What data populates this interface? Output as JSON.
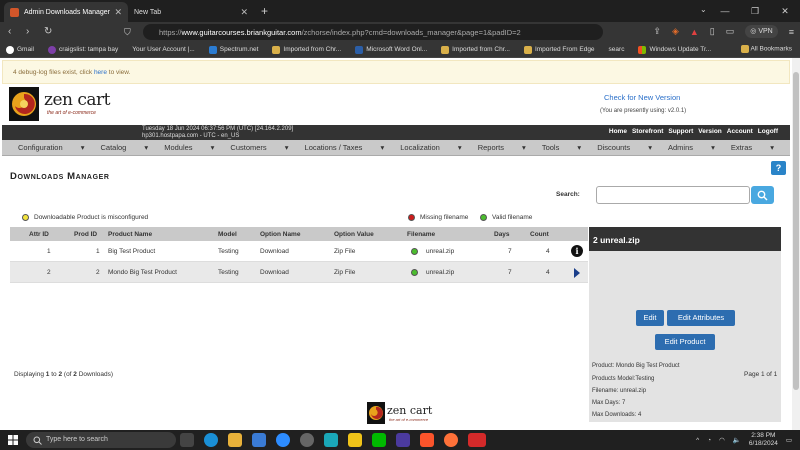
{
  "browser": {
    "tabs": [
      {
        "title": "Admin Downloads Manager",
        "active": true
      },
      {
        "title": "New Tab",
        "active": false
      }
    ],
    "url_prefix": "https://",
    "url_host": "www.guitarcourses.briankguitar.com",
    "url_path": "/zchorse/index.php?cmd=downloads_manager&page=1&padID=2",
    "vpn_label": "VPN",
    "bookmarks": [
      "Gmail",
      "craigslist: tampa bay",
      "Your User Account |...",
      "Spectrum.net",
      "Imported from Chr...",
      "Microsoft Word Onl...",
      "Imported from Chr...",
      "Imported From Edge",
      "searc",
      "Windows Update Tr..."
    ],
    "all_bookmarks": "All Bookmarks"
  },
  "debug": {
    "text_before": "4 debug-log files exist, click ",
    "link": "here",
    "text_after": " to view."
  },
  "logo": {
    "text": "zen cart",
    "tagline": "the art of e-commerce"
  },
  "version": {
    "check_link": "Check for New Version",
    "using": "(You are presently using: v2.0.1)"
  },
  "header": {
    "date": "Tuesday 18 Jun 2024 06:37:56 PM (UTC) [24.164.2.209]",
    "host": "hp301.hostpapa.com - UTC - en_US",
    "links": [
      "Home",
      "Storefront",
      "Support",
      "Version",
      "Account",
      "Logoff"
    ]
  },
  "menu": [
    "Configuration",
    "Catalog",
    "Modules",
    "Customers",
    "Locations / Taxes",
    "Localization",
    "Reports",
    "Tools",
    "Discounts",
    "Admins",
    "Extras"
  ],
  "page": {
    "title": "Downloads Manager",
    "search_label": "Search:",
    "search_placeholder": ""
  },
  "legend": {
    "misconfigured": "Downloadable Product is misconfigured",
    "missing": "Missing filename",
    "valid": "Valid filename"
  },
  "table": {
    "headers": {
      "attr_id": "Attr ID",
      "prod_id": "Prod ID",
      "product_name": "Product Name",
      "model": "Model",
      "option_name": "Option Name",
      "option_value": "Option Value",
      "filename": "Filename",
      "days": "Days",
      "count": "Count"
    },
    "rows": [
      {
        "attr_id": "1",
        "prod_id": "1",
        "product_name": "Big Test Product",
        "model": "Testing",
        "option_name": "Download",
        "option_value": "Zip File",
        "filename": "unreal.zip",
        "days": "7",
        "count": "4",
        "status": "valid"
      },
      {
        "attr_id": "2",
        "prod_id": "2",
        "product_name": "Mondo Big Test Product",
        "model": "Testing",
        "option_name": "Download",
        "option_value": "Zip File",
        "filename": "unreal.zip",
        "days": "7",
        "count": "4",
        "status": "valid",
        "selected": true
      }
    ],
    "displaying_prefix": "Displaying ",
    "displaying_from": "1",
    "displaying_to_word": " to ",
    "displaying_to": "2",
    "displaying_of_prefix": " (of ",
    "displaying_total": "2",
    "displaying_suffix": " Downloads)",
    "page_of": "Page 1 of 1"
  },
  "infobox": {
    "heading": "2 unreal.zip",
    "edit_label": "Edit",
    "edit_attributes_label": "Edit Attributes",
    "edit_product_label": "Edit Product",
    "product": "Product: Mondo Big Test Product",
    "model": "Products Model:Testing",
    "filename": "Filename: unreal.zip",
    "max_days": "Max Days: 7",
    "max_downloads": "Max Downloads: 4"
  },
  "taskbar": {
    "search_placeholder": "Type here to search",
    "time": "2:38 PM",
    "date": "6/18/2024"
  },
  "colors": {
    "accent_blue": "#2d6db0",
    "header_dark": "#333333",
    "menu_gray": "#c9c9c9"
  }
}
